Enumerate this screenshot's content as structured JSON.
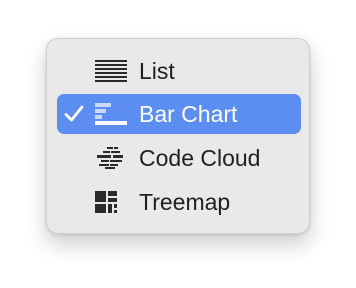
{
  "menu": {
    "items": [
      {
        "label": "List",
        "icon": "list-icon",
        "selected": false
      },
      {
        "label": "Bar Chart",
        "icon": "bar-chart-icon",
        "selected": true
      },
      {
        "label": "Code Cloud",
        "icon": "code-cloud-icon",
        "selected": false
      },
      {
        "label": "Treemap",
        "icon": "treemap-icon",
        "selected": false
      }
    ]
  },
  "colors": {
    "menu_background": "#e9e9e9",
    "selection": "#5b8ef0",
    "text": "#1f1f1f",
    "selected_text": "#ffffff"
  }
}
